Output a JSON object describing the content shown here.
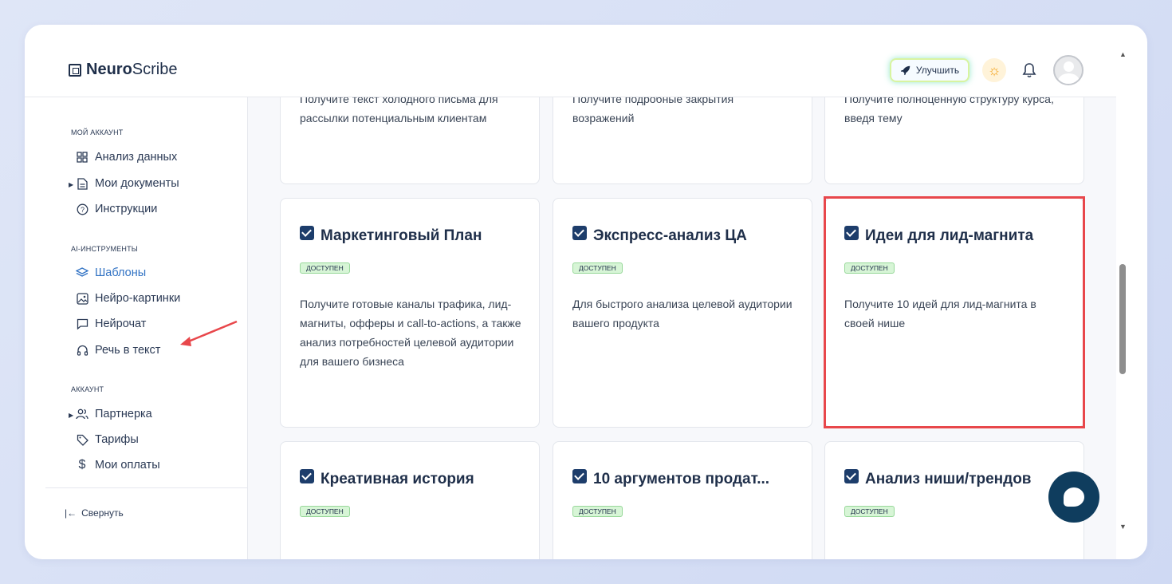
{
  "app": {
    "logo_bold": "Neuro",
    "logo_rest": "Scribe"
  },
  "header": {
    "upgrade_label": "Улучшить"
  },
  "sidebar": {
    "section_account": "МОЙ АККАУНТ",
    "items_account": [
      "Анализ данных",
      "Мои документы",
      "Инструкции"
    ],
    "section_ai": "AI-ИНСТРУМЕНТЫ",
    "items_ai": [
      "Шаблоны",
      "Нейро-картинки",
      "Нейрочат",
      "Речь в текст"
    ],
    "section_profile": "АККАУНТ",
    "items_profile": [
      "Партнерка",
      "Тарифы",
      "Мои оплаты"
    ],
    "collapse_label": "Свернуть"
  },
  "cards_top": [
    {
      "desc": "Получите текст холодного письма для рассылки потенциальным клиентам"
    },
    {
      "desc": "Получите подробные закрытия возражений"
    },
    {
      "desc": "Получите полноценную структуру курса, введя тему"
    }
  ],
  "cards_mid": [
    {
      "title": "Маркетинговый План",
      "badge": "ДОСТУПЕН",
      "desc": "Получите готовые каналы трафика, лид-магниты, офферы и call-to-actions, а также анализ потребностей целевой аудитории для вашего бизнеса"
    },
    {
      "title": "Экспресс-анализ ЦА",
      "badge": "ДОСТУПЕН",
      "desc": "Для быстрого анализа целевой аудитории вашего продукта"
    },
    {
      "title": "Идеи для лид-магнита",
      "badge": "ДОСТУПЕН",
      "desc": "Получите 10 идей для лид-магнита в своей нише"
    }
  ],
  "cards_bottom": [
    {
      "title": "Креативная история",
      "badge": "ДОСТУПЕН"
    },
    {
      "title": "10 аргументов продат...",
      "badge": "ДОСТУПЕН"
    },
    {
      "title": "Анализ ниши/трендов",
      "badge": "ДОСТУПЕН"
    }
  ]
}
